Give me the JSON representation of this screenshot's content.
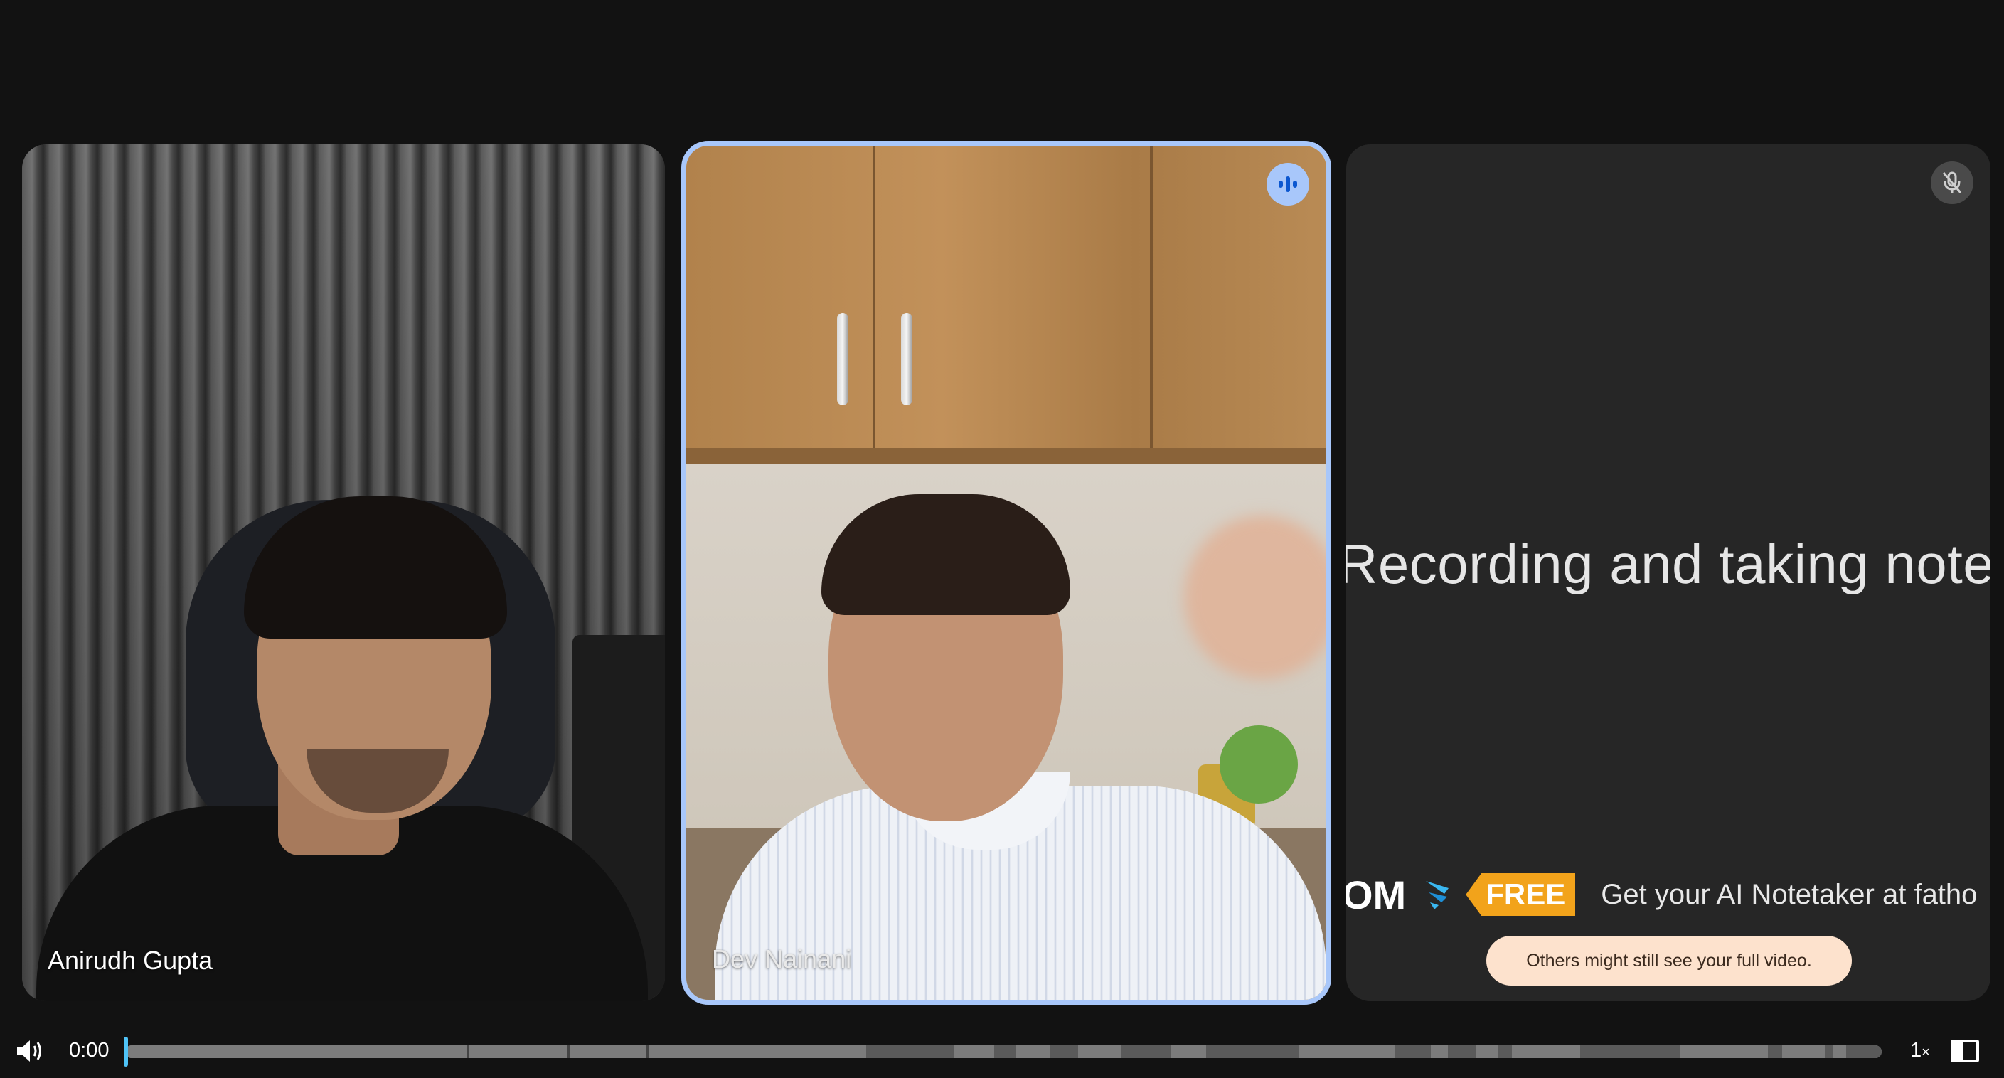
{
  "participants": [
    {
      "name": "Anirudh Gupta"
    },
    {
      "name": "Dev Nainani"
    },
    {
      "promo_title": "Recording and taking notes",
      "promo_brand_fragment": "OM",
      "promo_badge": "FREE",
      "promo_text": "Get your AI Notetaker at fatho",
      "notice": "Others might still see your full video."
    }
  ],
  "player": {
    "current_time": "0:00",
    "speed": "1",
    "speed_suffix": "×",
    "progress": 0
  },
  "colors": {
    "speaking_ring": "#a8c7fa",
    "playhead": "#4fc3f7",
    "promo_badge": "#f2a31b",
    "notice_bg": "#fde2cd"
  },
  "icons": [
    "audio-level-icon",
    "mic-off-icon",
    "fathom-logo-icon",
    "volume-icon",
    "picture-in-picture-icon"
  ]
}
